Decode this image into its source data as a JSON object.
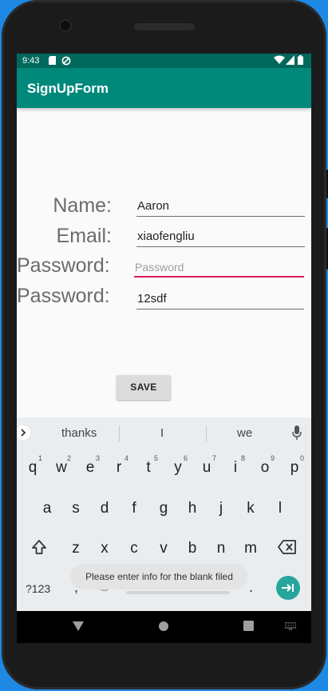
{
  "status_bar": {
    "time": "9:43"
  },
  "app_bar": {
    "title": "SignUpForm"
  },
  "form": {
    "name_label": "Name:",
    "name_value": "Aaron",
    "email_label": "Email:",
    "email_value": "xiaofengliu",
    "password_label": "Password:",
    "password_placeholder": "Password",
    "confirm_label": "Password:",
    "confirm_value": "12sdf",
    "save_label": "SAVE"
  },
  "keyboard": {
    "suggestions": [
      "thanks",
      "I",
      "we"
    ],
    "row1": [
      {
        "key": "q",
        "hint": "1"
      },
      {
        "key": "w",
        "hint": "2"
      },
      {
        "key": "e",
        "hint": "3"
      },
      {
        "key": "r",
        "hint": "4"
      },
      {
        "key": "t",
        "hint": "5"
      },
      {
        "key": "y",
        "hint": "6"
      },
      {
        "key": "u",
        "hint": "7"
      },
      {
        "key": "i",
        "hint": "8"
      },
      {
        "key": "o",
        "hint": "9"
      },
      {
        "key": "p",
        "hint": "0"
      }
    ],
    "row2": [
      "a",
      "s",
      "d",
      "f",
      "g",
      "h",
      "j",
      "k",
      "l"
    ],
    "row3": [
      "z",
      "x",
      "c",
      "v",
      "b",
      "n",
      "m"
    ],
    "symbols_label": "?123",
    "comma_label": ",",
    "period_label": "."
  },
  "toast": {
    "message": "Please enter info for the blank filed"
  },
  "colors": {
    "primary": "#00897b",
    "primary_dark": "#00695c",
    "accent": "#d81b60"
  },
  "icons": [
    "sim-card-icon",
    "blocked-icon",
    "wifi-icon",
    "signal-icon",
    "battery-icon",
    "chevron-right-icon",
    "microphone-icon",
    "shift-icon",
    "backspace-icon",
    "emoji-icon",
    "enter-icon",
    "back-icon",
    "home-icon",
    "recents-icon",
    "keyboard-switch-icon"
  ]
}
